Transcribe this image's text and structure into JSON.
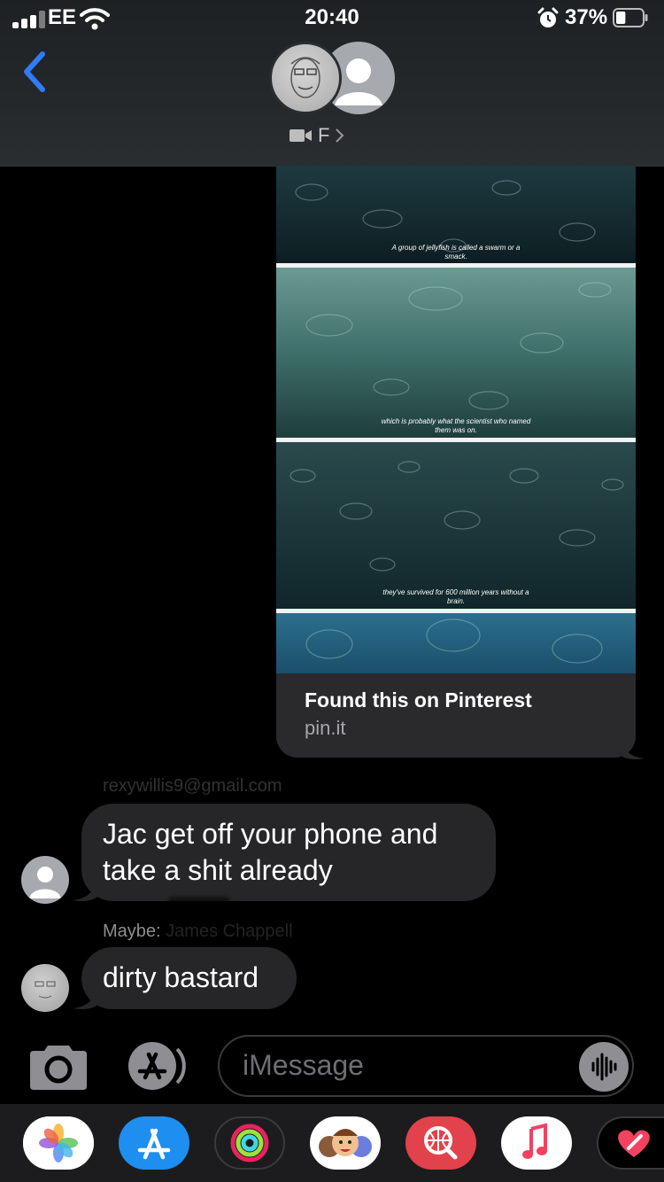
{
  "status_bar": {
    "carrier": "EE",
    "time": "20:40",
    "battery_percent": "37%",
    "battery_level": 0.37
  },
  "header": {
    "back_icon": "chevron-left-icon",
    "group_label": "F",
    "facetime_icon": "video-camera-icon",
    "disclosure_icon": "chevron-right-icon"
  },
  "link_preview": {
    "captions": [
      "A group of jellyfish is called a swarm or a smack.",
      "which is probably what the scientist who named them was on.",
      "they've survived for 600 million years without a brain."
    ],
    "title": "Found this on Pinterest",
    "domain": "pin.it"
  },
  "messages": [
    {
      "sender": "rexywillis9@gmail.com",
      "text_lines": [
        "Jac get off your phone and",
        "take a shit already"
      ],
      "avatar": "person-placeholder-icon"
    },
    {
      "sender_prefix": "Maybe:",
      "sender": "James Chappell",
      "text": "dirty bastard",
      "avatar": "contact-photo"
    }
  ],
  "compose": {
    "placeholder": "iMessage",
    "camera_icon": "camera-icon",
    "apps_icon": "app-store-icon",
    "audio_icon": "waveform-icon"
  },
  "app_drawer": [
    {
      "name": "photos-app-icon",
      "bg": "#ffffff"
    },
    {
      "name": "app-store-app-icon",
      "bg": "#1e8ef0"
    },
    {
      "name": "activity-app-icon",
      "bg": "#1c1c1e"
    },
    {
      "name": "memoji-app-icon",
      "bg": "#ffffff"
    },
    {
      "name": "image-search-app-icon",
      "bg": "#e2424b"
    },
    {
      "name": "music-app-icon",
      "bg": "#ffffff"
    },
    {
      "name": "digital-touch-app-icon",
      "bg": "#000000"
    }
  ],
  "colors": {
    "accent_blue": "#2f7cf6",
    "bubble_gray": "#262628",
    "background": "#000000"
  }
}
